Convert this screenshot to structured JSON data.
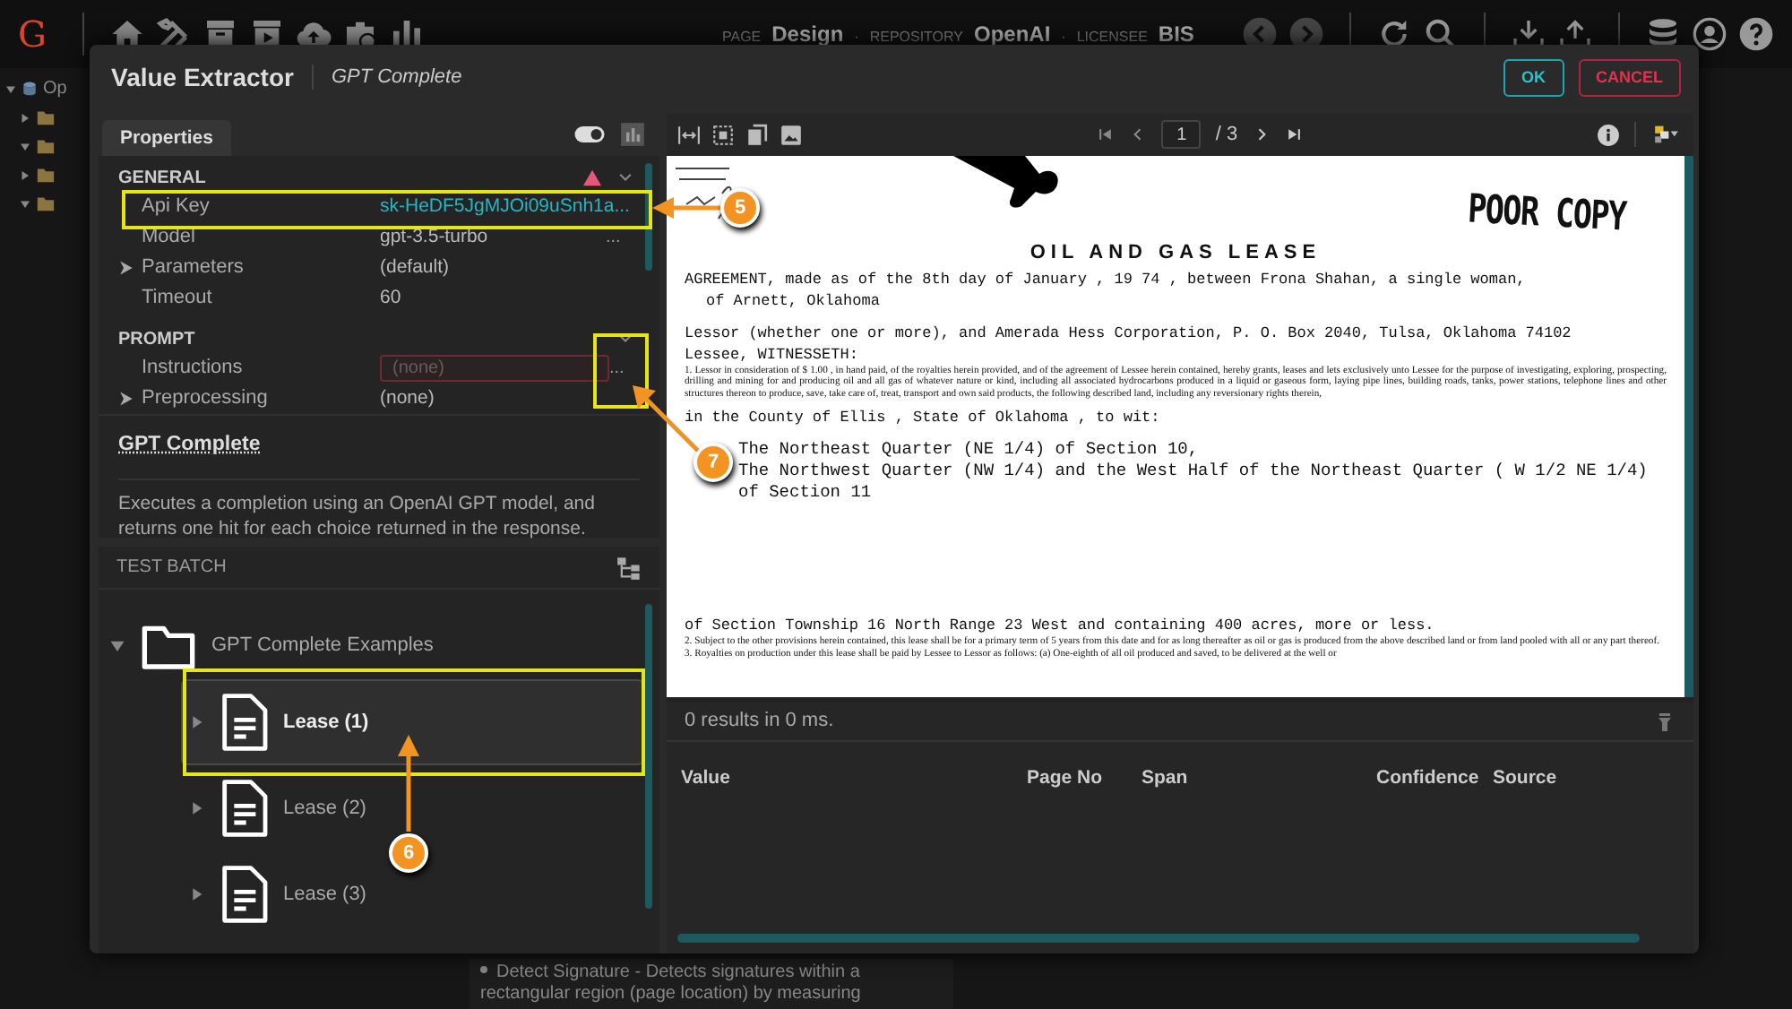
{
  "app_bar": {
    "logo": "G",
    "context": [
      {
        "label": "PAGE",
        "value": "Design"
      },
      {
        "label": "REPOSITORY",
        "value": "OpenAI"
      },
      {
        "label": "LICENSEE",
        "value": "BIS"
      }
    ],
    "separator": "·"
  },
  "background": {
    "tree": [
      {
        "label": "Op",
        "expanded": true,
        "children": [
          {
            "expanded": false
          },
          {
            "expanded": true
          },
          {
            "expanded": false
          },
          {
            "expanded": true
          }
        ]
      }
    ],
    "note": {
      "link": "Detect Signature",
      "text": " - Detects signatures within a rectangular region (page location) by measuring"
    }
  },
  "dialog": {
    "title": "Value Extractor",
    "subtitle": "GPT Complete",
    "buttons": [
      {
        "label": "OK",
        "kind": "ok"
      },
      {
        "label": "CANCEL",
        "kind": "cancel"
      }
    ]
  },
  "properties": {
    "tab": "Properties",
    "sections": [
      {
        "title": "GENERAL",
        "warning": true,
        "expanded": true,
        "rows": [
          {
            "label": "Api Key",
            "value": "sk-HeDF5JgMJOi09uSnh1a...",
            "kind": "secret",
            "expandable": false
          },
          {
            "label": "Model",
            "value": "gpt-3.5-turbo",
            "kind": "text",
            "expandable": false,
            "action": "..."
          },
          {
            "label": "Parameters",
            "value": "(default)",
            "kind": "text",
            "expandable": true
          },
          {
            "label": "Timeout",
            "value": "60",
            "kind": "text",
            "expandable": false
          }
        ]
      },
      {
        "title": "PROMPT",
        "warning": false,
        "expanded": true,
        "rows": [
          {
            "label": "Instructions",
            "placeholder": "(none)",
            "kind": "field",
            "invalid": true,
            "expandable": false,
            "action": "..."
          },
          {
            "label": "Preprocessing",
            "value": "(none)",
            "kind": "text",
            "expandable": true
          }
        ]
      }
    ],
    "description": {
      "title": "GPT Complete",
      "before": "Executes a completion using an ",
      "link": "OpenAI",
      "after": " GPT model, and returns one hit for each choice returned in the response."
    }
  },
  "test_batch": {
    "title": "TEST BATCH",
    "tree": [
      {
        "label": "GPT Complete Examples",
        "expanded": true,
        "children": [
          {
            "label": "Lease (1)",
            "selected": true,
            "expanded": false
          },
          {
            "label": "Lease (2)",
            "selected": false,
            "expanded": false
          },
          {
            "label": "Lease (3)",
            "selected": false,
            "expanded": false
          }
        ]
      }
    ]
  },
  "viewer": {
    "page": "1",
    "page_count": "/ 3",
    "document": {
      "stamp": "POOR COPY",
      "title": "OIL AND GAS LEASE",
      "header_lines": [
        "AGREEMENT, made as of the 8th day of January , 19 74 , between Frona Shahan, a single woman,",
        "of Arnett, Oklahoma",
        "Lessor (whether one or more), and Amerada Hess Corporation, P. O. Box 2040, Tulsa, Oklahoma 74102",
        "Lessee, WITNESSETH:"
      ],
      "grant_clause": "1. Lessor in consideration of $ 1.00 , in hand paid, of the royalties herein provided, and of the agreement of Lessee herein contained, hereby grants, leases and lets exclusively unto Lessee for the purpose of investigating, exploring, prospecting, drilling and mining for and producing oil and all gas of whatever nature or kind, including all associated hydrocarbons produced in a liquid or gaseous form, laying pipe lines, building roads, tanks, power stations, telephone lines and other structures thereon to produce, save, take care of, treat, transport and own said products, the following described land, including any reversionary rights therein,",
      "county_line": "in the County of Ellis , State of Oklahoma , to wit:",
      "legal_description": [
        "The Northeast Quarter (NE 1/4) of Section 10,",
        "The Northwest Quarter (NW 1/4) and the West Half of the Northeast Quarter ( W 1/2 NE 1/4)",
        "of Section 11"
      ],
      "township_line": "of Section Township 16 North Range 23 West and containing 400 acres, more or less.",
      "terms": [
        "2. Subject to the other provisions herein contained, this lease shall be for a primary term of 5 years from this date and for as long thereafter as oil or gas is produced from the above described land or from land pooled with all or any part thereof.",
        "3. Royalties on production under this lease shall be paid by Lessee to Lessor as follows: (a) One-eighth of all oil produced and saved, to be delivered at the well or"
      ]
    }
  },
  "results": {
    "summary": "0 results in 0 ms.",
    "columns": [
      "Value",
      "Page No",
      "Span",
      "Confidence",
      "Source"
    ]
  },
  "callouts": [
    {
      "number": "5"
    },
    {
      "number": "7"
    },
    {
      "number": "6"
    }
  ]
}
